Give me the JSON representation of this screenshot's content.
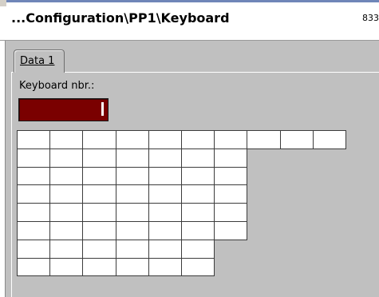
{
  "header": {
    "title": "...Configuration\\PP1\\Keyboard",
    "code": "833"
  },
  "tabs": [
    {
      "label": "Data 1",
      "active": true
    }
  ],
  "form": {
    "keyboard_label": "Keyboard nbr.:",
    "keyboard_value": ""
  },
  "colors": {
    "input_background": "#7a0000",
    "window_background": "#c0c0c0"
  },
  "key_grid": {
    "rows": [
      10,
      7,
      7,
      7,
      7,
      7,
      6,
      6
    ]
  }
}
